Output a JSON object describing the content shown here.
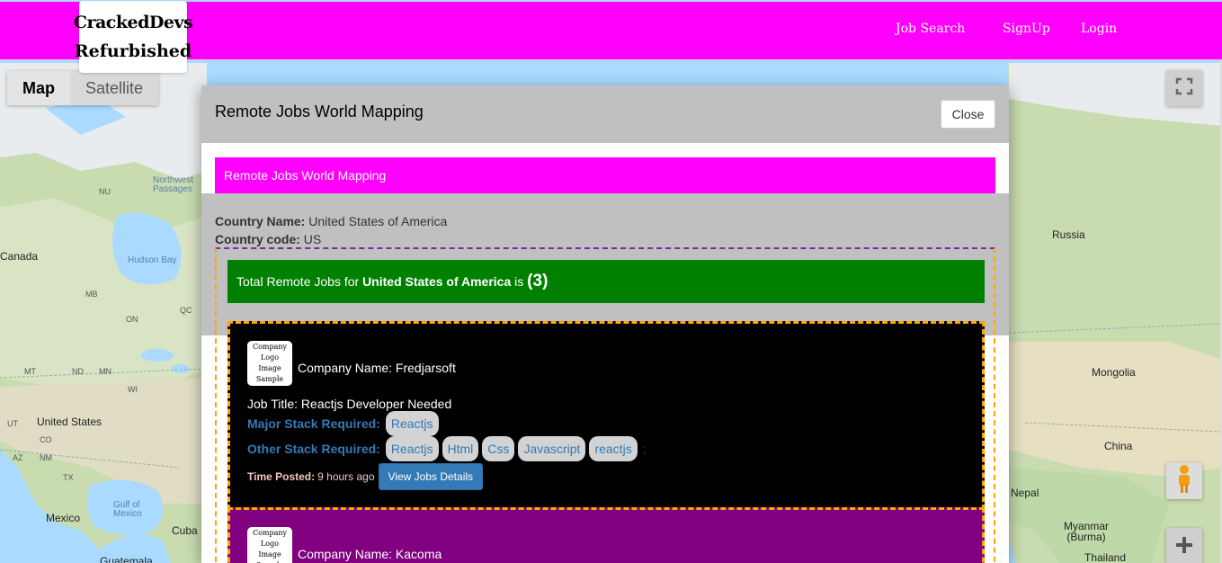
{
  "header": {
    "logo_line1": "CrackedDevs",
    "logo_line2": "Refurbished",
    "nav": [
      "Job Search",
      "SignUp",
      "Login"
    ]
  },
  "map": {
    "type_buttons": [
      "Map",
      "Satellite"
    ],
    "labels": {
      "canada": "Canada",
      "hudson_bay": "Hudson Bay",
      "northwest_passages": "Northwest Passages",
      "nu": "NU",
      "mb": "MB",
      "on": "ON",
      "qc": "QC",
      "mt": "MT",
      "nd": "ND",
      "mn": "MN",
      "wi": "WI",
      "ut": "UT",
      "co": "CO",
      "az": "AZ",
      "nm": "NM",
      "tx": "TX",
      "united_states": "United States",
      "gulf_of_mexico": "Gulf of Mexico",
      "mexico": "Mexico",
      "cuba": "Cuba",
      "guatemala": "Guatemala",
      "russia": "Russia",
      "mongolia": "Mongolia",
      "china": "China",
      "nepal": "Nepal",
      "myanmar": "Myanmar (Burma)",
      "thailand": "Thailand"
    }
  },
  "modal": {
    "title": "Remote Jobs World Mapping",
    "close_label": "Close",
    "banner": "Remote Jobs World Mapping",
    "country_name_label": "Country Name:",
    "country_name": "United States of America",
    "country_code_label": "Country code:",
    "country_code": "US",
    "total_prefix": "Total Remote Jobs for",
    "total_country": "United States of America",
    "total_is": "is",
    "total_count": "(3)"
  },
  "jobs": [
    {
      "logo_line1": "Company Logo",
      "logo_line2": "Image Sample",
      "company": "Company Name: Fredjarsoft",
      "title": "Job Title: Reactjs Developer Needed",
      "major_label": "Major Stack Required:",
      "major": [
        "Reactjs"
      ],
      "other_label": "Other Stack Required:",
      "other": [
        "Reactjs",
        "Html",
        "Css",
        "Javascript",
        "reactjs"
      ],
      "separator": ";",
      "posted_label": "Time Posted:",
      "posted": "9 hours ago",
      "view_label": "View Jobs Details"
    },
    {
      "logo_line1": "Company Logo",
      "logo_line2": "Image Sample",
      "company": "Company Name: Kacoma"
    }
  ],
  "colors": {
    "header": "#ff00ff",
    "banner": "#ff00ff",
    "total_bar": "#008000",
    "card1": "#000000",
    "card2": "#800080",
    "link": "#337ab7",
    "dash": "#ffa500"
  },
  "icons": [
    "fullscreen-icon",
    "pegman-icon",
    "zoom-in-icon"
  ]
}
